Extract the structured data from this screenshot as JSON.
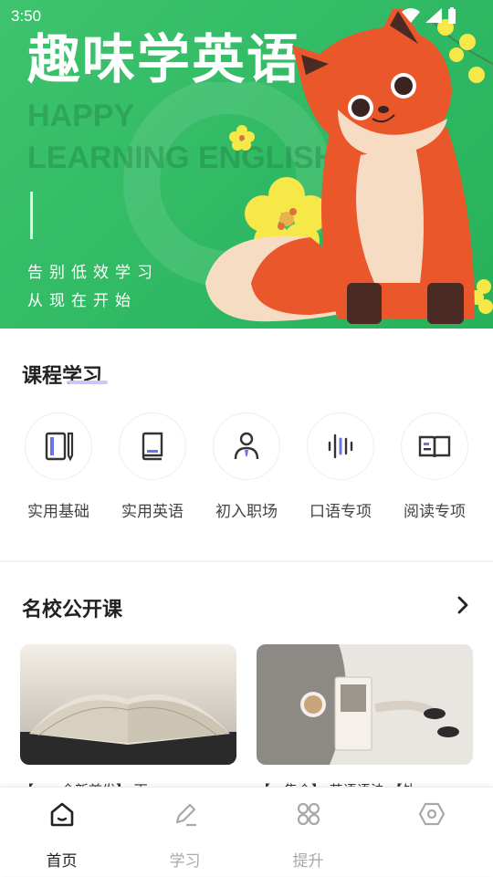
{
  "status_bar": {
    "time": "3:50"
  },
  "banner": {
    "title": "趣味学英语",
    "en_line1": "HAPPY",
    "en_line2": "LEARNING ENGLISH",
    "sub_line1": "告别低效学习",
    "sub_line2": "从现在开始"
  },
  "courses": {
    "title": "课程学习",
    "items": [
      {
        "label": "实用基础",
        "icon": "notebook-pen-icon"
      },
      {
        "label": "实用英语",
        "icon": "book-icon"
      },
      {
        "label": "初入职场",
        "icon": "person-tie-icon"
      },
      {
        "label": "口语专项",
        "icon": "sound-wave-icon"
      },
      {
        "label": "阅读专项",
        "icon": "open-book-icon"
      }
    ]
  },
  "public_courses": {
    "title": "名校公开课",
    "more_icon": "chevron-right-icon",
    "cards": [
      {
        "caption": "【……全新首发】 雨…"
      },
      {
        "caption": "【…集合】 英语语法 【外…"
      }
    ]
  },
  "tabbar": {
    "tabs": [
      {
        "label": "首页",
        "icon": "home-icon",
        "active": true
      },
      {
        "label": "学习",
        "icon": "edit-icon",
        "active": false
      },
      {
        "label": "提升",
        "icon": "grid-icon",
        "active": false
      },
      {
        "label": "",
        "icon": "hexagon-icon",
        "active": false
      }
    ]
  },
  "colors": {
    "accent": "#3ec36e",
    "text": "#222222",
    "inactive": "#a8a8a8"
  }
}
